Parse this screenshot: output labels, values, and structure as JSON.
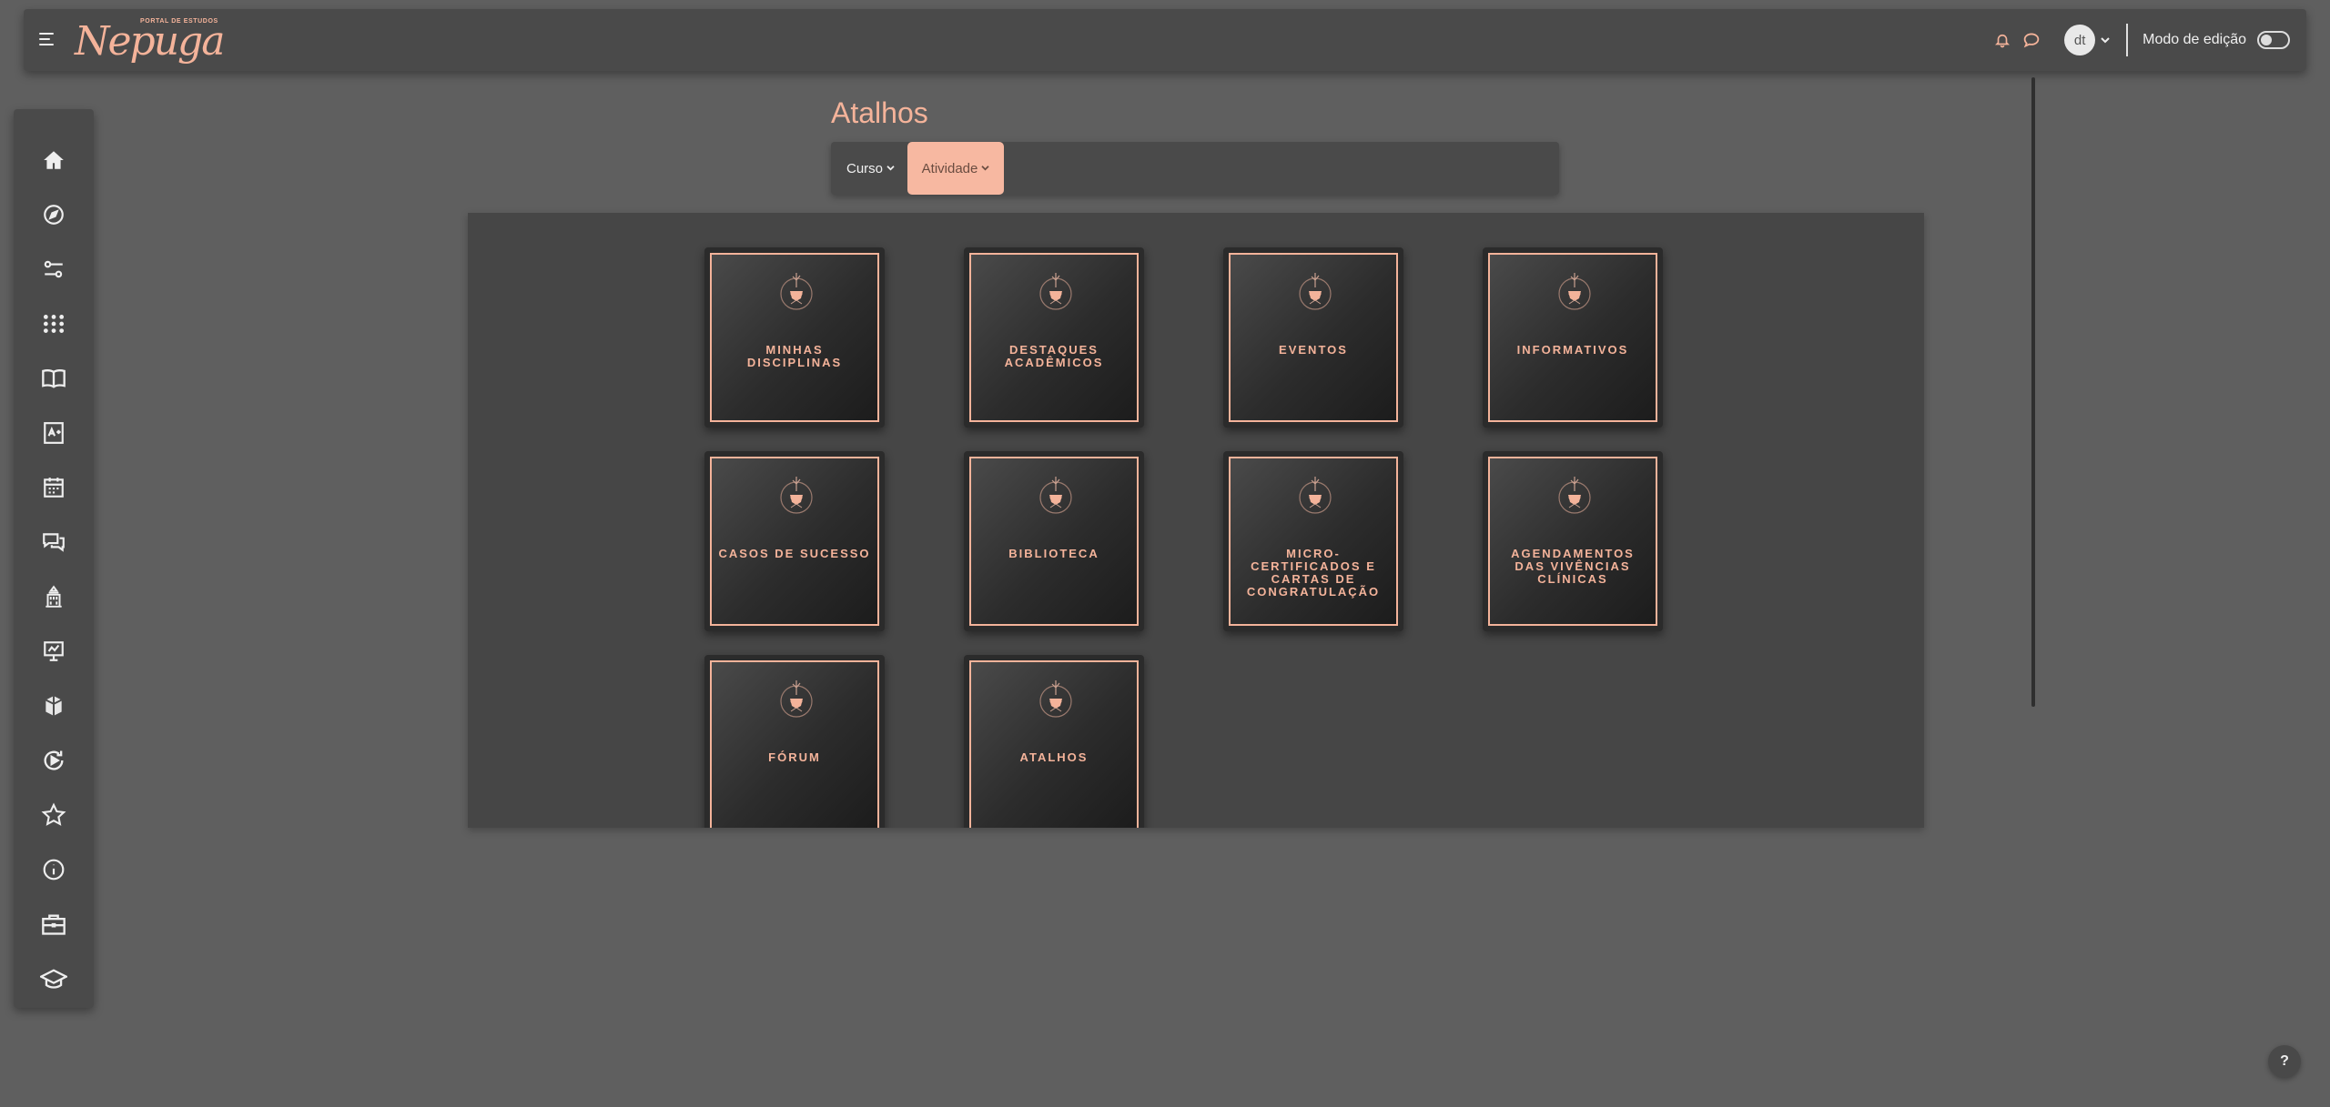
{
  "brand": {
    "tagline": "PORTAL DE ESTUDOS",
    "name": "Nepuga",
    "accent_color": "#f4b39a"
  },
  "navbar": {
    "avatar_initials": "dt",
    "edit_mode_label": "Modo de edição",
    "edit_mode_on": false,
    "icons": [
      "menu-icon",
      "bell-icon",
      "chat-bubble-icon",
      "chevron-down-icon"
    ]
  },
  "sidebar": {
    "items": [
      {
        "icon": "home-icon"
      },
      {
        "icon": "compass-icon"
      },
      {
        "icon": "sliders-icon"
      },
      {
        "icon": "apps-grid-icon"
      },
      {
        "icon": "book-icon"
      },
      {
        "icon": "grades-icon"
      },
      {
        "icon": "calendar-icon"
      },
      {
        "icon": "messages-icon"
      },
      {
        "icon": "institution-icon"
      },
      {
        "icon": "presentation-icon"
      },
      {
        "icon": "books-stack-icon"
      },
      {
        "icon": "play-circle-icon"
      },
      {
        "icon": "star-icon"
      },
      {
        "icon": "info-icon"
      },
      {
        "icon": "briefcase-icon"
      },
      {
        "icon": "graduation-cap-icon"
      }
    ]
  },
  "page": {
    "title": "Atalhos",
    "filters": {
      "curso_label": "Curso",
      "atividade_label": "Atividade",
      "active": "Atividade"
    }
  },
  "tiles": [
    {
      "label": "Minhas Disciplinas"
    },
    {
      "label": "Destaques Acadêmicos"
    },
    {
      "label": "Eventos"
    },
    {
      "label": "Informativos"
    },
    {
      "label": "Casos de Sucesso"
    },
    {
      "label": "Biblioteca"
    },
    {
      "label": "Micro-certificados e cartas de congratulação"
    },
    {
      "label": "Agendamentos das vivências clínicas"
    },
    {
      "label": "Fórum"
    },
    {
      "label": "Atalhos"
    }
  ],
  "help": {
    "label": "?"
  }
}
